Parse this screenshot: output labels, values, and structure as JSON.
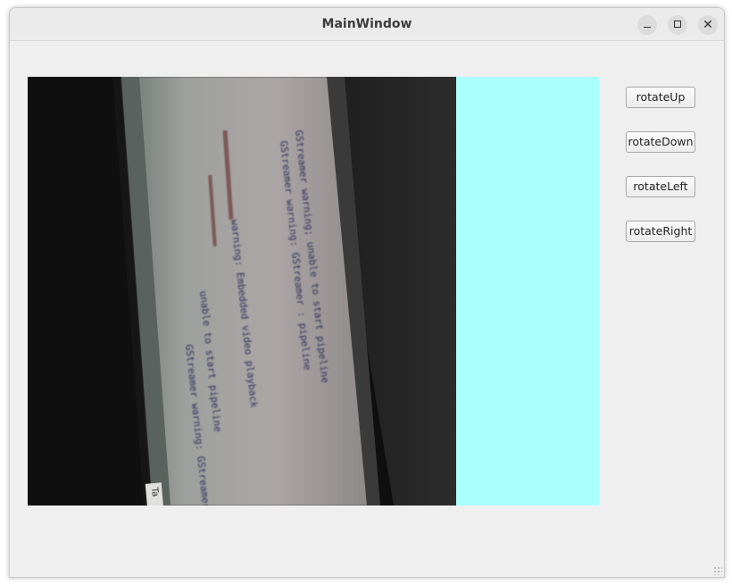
{
  "window": {
    "title": "MainWindow",
    "controls": {
      "minimize": "minimize-icon",
      "maximize": "maximize-icon",
      "close": "close-icon"
    }
  },
  "video": {
    "content": "camera-feed",
    "overlay_lines": [
      "GStreamer warning; unable to start pipeline",
      "GStreamer warning: GStreamer : pipeline",
      "warning: Embedded video playback",
      "unable to start pipeline",
      "GStreamer warning: GStreamer: pipeline",
      "Ta"
    ]
  },
  "side_pane": {
    "color": "#aaffff"
  },
  "buttons": {
    "rotate_up": "rotateUp",
    "rotate_down": "rotateDown",
    "rotate_left": "rotateLeft",
    "rotate_right": "rotateRight"
  }
}
